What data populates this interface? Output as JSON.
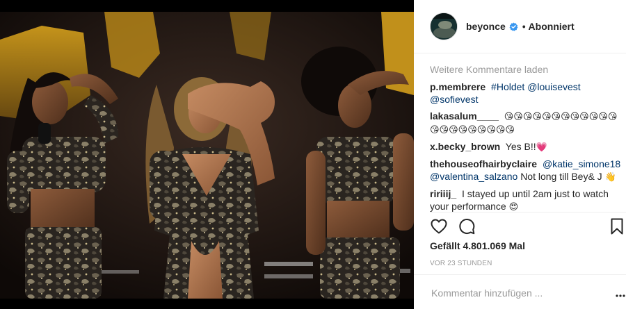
{
  "photo": {
    "alt": "Drei Performerinnen in glitzernden Camouflage-Outfits salutieren auf der Bühne"
  },
  "header": {
    "username": "beyonce",
    "verified_icon": "verified-badge-icon",
    "separator": "•",
    "follow_status": "Abonniert"
  },
  "comments": {
    "load_more": "Weitere Kommentare laden",
    "items": [
      {
        "user": "p.membrere",
        "parts": [
          "#Holdet",
          "@louisevest",
          "@sofievest"
        ]
      },
      {
        "user": "lakasalum____",
        "emoji": "😘😘😘😘😘😘😘😘😘😘😘😘😘😘😘😘😘😘😘😘😘"
      },
      {
        "user": "x.becky_brown",
        "text": "Yes B!!",
        "emoji": "💗"
      },
      {
        "user": "thehouseofhairbyclaire",
        "mention1": "@katie_simone18",
        "mention2": "@valentina_salzano",
        "text": "Not long till Bey& J",
        "emoji": "👋"
      },
      {
        "user": "ririiij_",
        "text": "I stayed up until 2am just to watch your performance",
        "emoji": "😍"
      }
    ]
  },
  "actions": {
    "like_icon": "heart-icon",
    "comment_icon": "comment-icon",
    "save_icon": "bookmark-icon"
  },
  "likes": "Gefällt 4.801.069 Mal",
  "timestamp": "VOR 23 STUNDEN",
  "comment_box": {
    "placeholder": "Kommentar hinzufügen ...",
    "options_icon": "more-options-icon"
  }
}
